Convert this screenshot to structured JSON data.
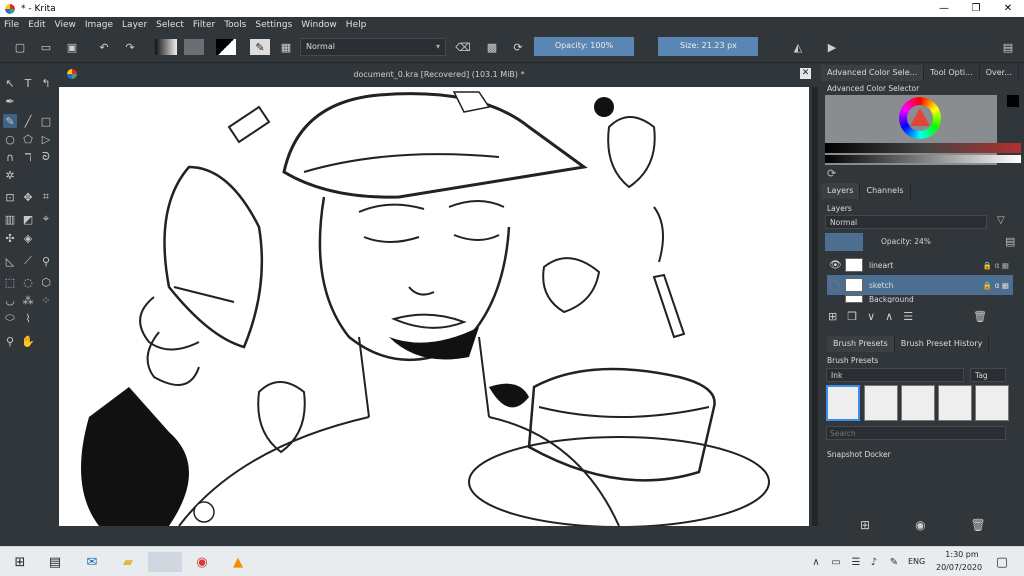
{
  "window": {
    "title": "* - Krita",
    "controls": [
      "—",
      "❐",
      "✕"
    ]
  },
  "menu": [
    "File",
    "Edit",
    "View",
    "Image",
    "Layer",
    "Select",
    "Filter",
    "Tools",
    "Settings",
    "Window",
    "Help"
  ],
  "toolbar": {
    "blend_mode": "Normal",
    "opacity": "Opacity: 100%",
    "size": "Size: 21.23 px"
  },
  "document": {
    "title": "document_0.kra [Recovered]  (103.1 MiB) *"
  },
  "dockers": {
    "top_tabs": [
      "Advanced Color Sele...",
      "Tool Opti...",
      "Over..."
    ],
    "color_selector_label": "Advanced Color Selector",
    "layer_tabs": [
      "Layers",
      "Channels"
    ],
    "layers_label": "Layers",
    "layer_blend": "Normal",
    "layer_opacity": "Opacity:  24%",
    "layers": [
      {
        "name": "lineart"
      },
      {
        "name": "sketch"
      },
      {
        "name": "Background"
      }
    ],
    "brush_tabs": [
      "Brush Presets",
      "Brush Preset History"
    ],
    "brush_label": "Brush Presets",
    "brush_tag": "Ink",
    "tag_button": "Tag",
    "search_placeholder": "Search",
    "snapshot_label": "Snapshot Docker"
  },
  "taskbar": {
    "lang": "ENG",
    "time": "1:30 pm",
    "date": "20/07/2020"
  },
  "colors": {
    "accent": "#3d6385",
    "panel": "#31363b",
    "selection": "#4b6e91"
  }
}
